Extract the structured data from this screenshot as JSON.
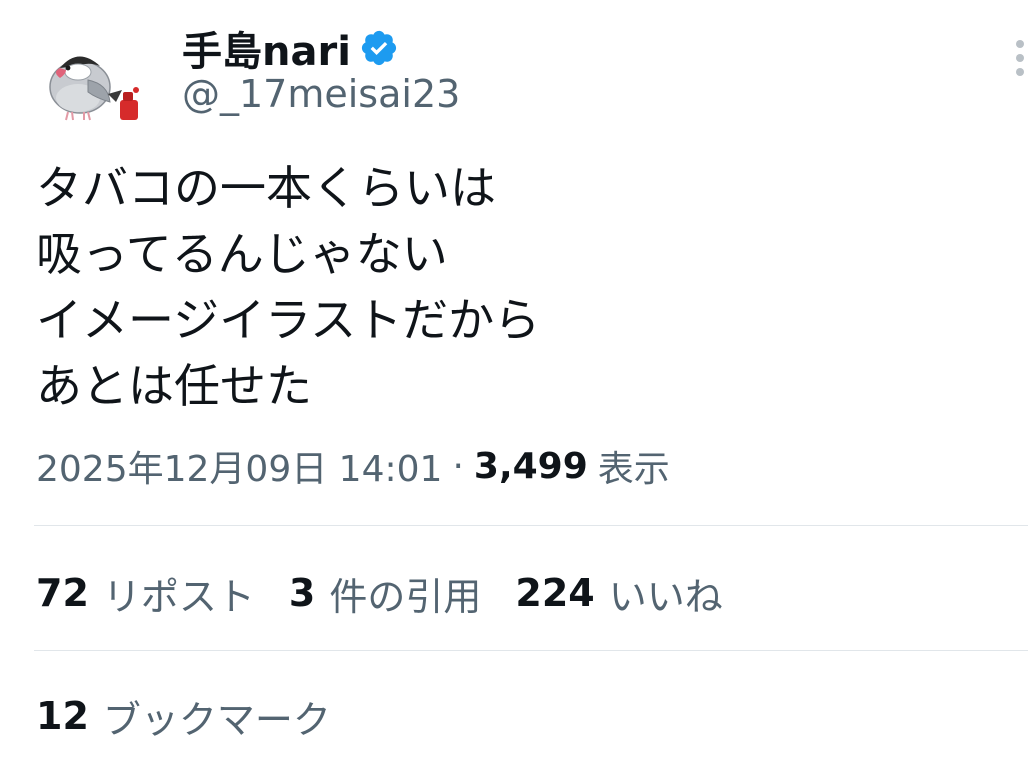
{
  "author": {
    "display_name": "手島nari",
    "handle": "@_17meisai23",
    "verified": true,
    "avatar_icon": "java-sparrow-avatar-icon",
    "verified_icon": "verified-badge-icon",
    "more_icon": "more-options-icon"
  },
  "tweet": {
    "lines": [
      "タバコの一本くらいは",
      "吸ってるんじゃない",
      "イメージイラストだから",
      "あとは任せた"
    ]
  },
  "meta": {
    "datetime": "2025年12月09日 14:01",
    "separator": "·",
    "views_count": "3,499",
    "views_label": "表示"
  },
  "stats": {
    "reposts": {
      "count": "72",
      "label": "リポスト"
    },
    "quotes": {
      "count": "3",
      "label": "件の引用"
    },
    "likes": {
      "count": "224",
      "label": "いいね"
    }
  },
  "bookmarks": {
    "count": "12",
    "label": "ブックマーク"
  },
  "colors": {
    "text_primary": "#0f1419",
    "text_secondary": "#536471",
    "verified_blue": "#1d9bf0",
    "divider": "#e1e6ea"
  }
}
